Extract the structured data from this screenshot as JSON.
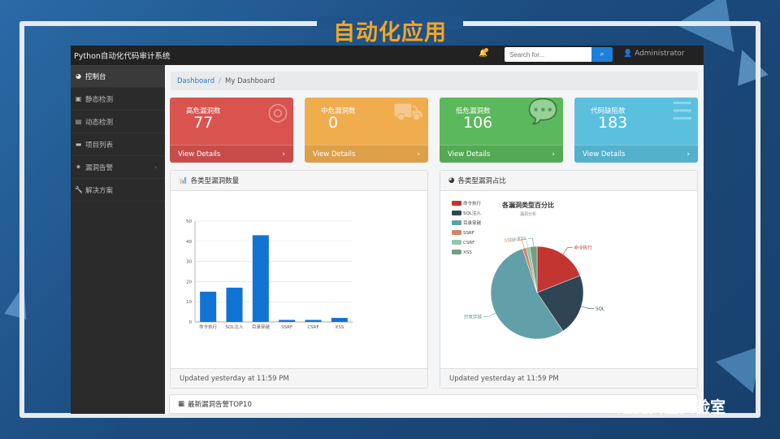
{
  "slide": {
    "title": "自动化应用",
    "watermark": "逢魔安全实验室"
  },
  "app": {
    "brand": "Python自动化代码审计系统",
    "search_placeholder": "Search for...",
    "user": "Administrator"
  },
  "sidebar": {
    "items": [
      "控制台",
      "静态检测",
      "动态检测",
      "项目列表",
      "漏洞告警",
      "解决方案"
    ]
  },
  "breadcrumb": [
    "Dashboard",
    "My Dashboard"
  ],
  "cards": [
    {
      "label": "高危漏洞数",
      "value": "77",
      "link": "View Details",
      "color": "#d9534f"
    },
    {
      "label": "中危漏洞数",
      "value": "0",
      "link": "View Details",
      "color": "#f0ad4e"
    },
    {
      "label": "低危漏洞数",
      "value": "106",
      "link": "View Details",
      "color": "#5cb85c"
    },
    {
      "label": "代码缺陷数",
      "value": "183",
      "link": "View Details",
      "color": "#5bc0de"
    }
  ],
  "panels": {
    "bar_title": "各类型漏洞数量",
    "pie_title": "各类型漏洞占比",
    "footer": "Updated yesterday at 11:59 PM",
    "table_title": "最新漏洞告警TOP10"
  },
  "chart_data": [
    {
      "type": "bar",
      "categories": [
        "命令执行",
        "SQL注入",
        "目录穿越",
        "SSRF",
        "CSRF",
        "XSS"
      ],
      "values": [
        15,
        17,
        43,
        1,
        1,
        2
      ],
      "ylim": [
        0,
        50
      ],
      "yticks": [
        0,
        10,
        20,
        30,
        40,
        50
      ],
      "grid": true,
      "color": "#1173d4"
    },
    {
      "type": "pie",
      "title": "各漏洞类型百分比",
      "subtitle": "漏洞分析",
      "labels": [
        "命令执行",
        "SQL注入",
        "目录穿越",
        "SSRF",
        "CSRF",
        "XSS"
      ],
      "values": [
        15,
        17,
        43,
        1,
        1,
        2
      ],
      "colors": [
        "#c23531",
        "#2f4554",
        "#61a0a8",
        "#d48265",
        "#91c7ae",
        "#749f83"
      ],
      "slice_labels": [
        "命令执行",
        "SQL",
        "目录穿越",
        "SSRF",
        "CSRF",
        "XSS"
      ],
      "legend": "top-left"
    }
  ]
}
